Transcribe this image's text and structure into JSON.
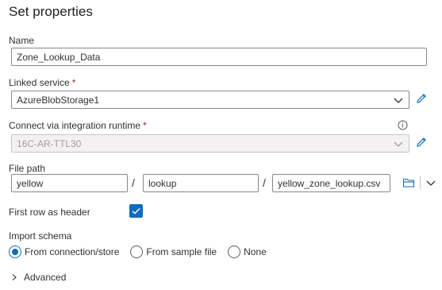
{
  "panel": {
    "title": "Set properties"
  },
  "name_field": {
    "label": "Name",
    "value": "Zone_Lookup_Data"
  },
  "linked_service": {
    "label": "Linked service",
    "required_mark": "*",
    "value": "AzureBlobStorage1"
  },
  "integration_runtime": {
    "label": "Connect via integration runtime",
    "required_mark": "*",
    "value": "16C-AR-TTL30",
    "info_icon": "info-icon"
  },
  "file_path": {
    "label": "File path",
    "container": "yellow",
    "directory": "lookup",
    "file": "yellow_zone_lookup.csv",
    "separator": "/"
  },
  "first_row_header": {
    "label": "First row as header",
    "checked": true
  },
  "import_schema": {
    "label": "Import schema",
    "options": [
      {
        "label": "From connection/store",
        "selected": true
      },
      {
        "label": "From sample file",
        "selected": false
      },
      {
        "label": "None",
        "selected": false
      }
    ]
  },
  "advanced": {
    "label": "Advanced"
  },
  "colors": {
    "accent": "#0f6cbd",
    "border": "#8a8886",
    "disabled_bg": "#f3f2f1",
    "required": "#a4262c"
  }
}
